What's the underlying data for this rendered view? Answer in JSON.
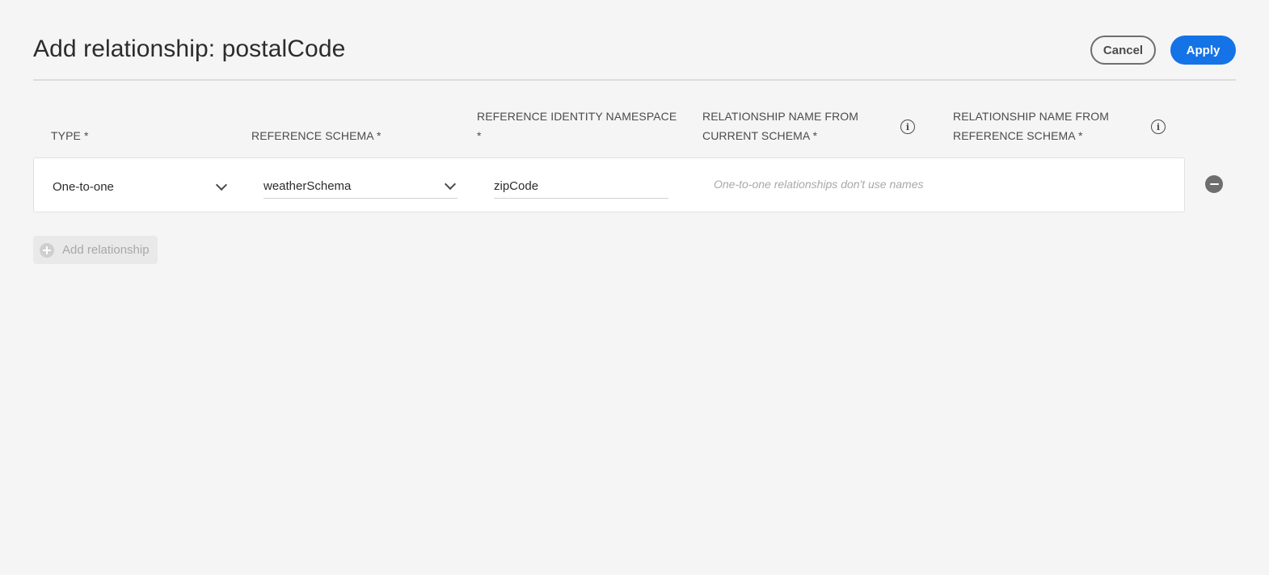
{
  "dialog": {
    "title": "Add relationship: postalCode",
    "cancel_label": "Cancel",
    "apply_label": "Apply"
  },
  "columns": {
    "type": "TYPE *",
    "reference_schema": "REFERENCE SCHEMA *",
    "namespace_line1": "REFERENCE IDENTITY NAMESPACE",
    "namespace_line2": "*",
    "name_current_line1": "RELATIONSHIP NAME FROM",
    "name_current_line2": "CURRENT SCHEMA *",
    "name_reference_line1": "RELATIONSHIP NAME FROM",
    "name_reference_line2": "REFERENCE SCHEMA *",
    "info_glyph": "i"
  },
  "relationship_row": {
    "type_value": "One-to-one",
    "reference_schema_value": "weatherSchema",
    "namespace_value": "zipCode",
    "names_hint": "One-to-one relationships don't use names"
  },
  "add_relationship_label": "Add relationship",
  "colors": {
    "accent": "#1473e6",
    "background": "#f5f5f5"
  }
}
